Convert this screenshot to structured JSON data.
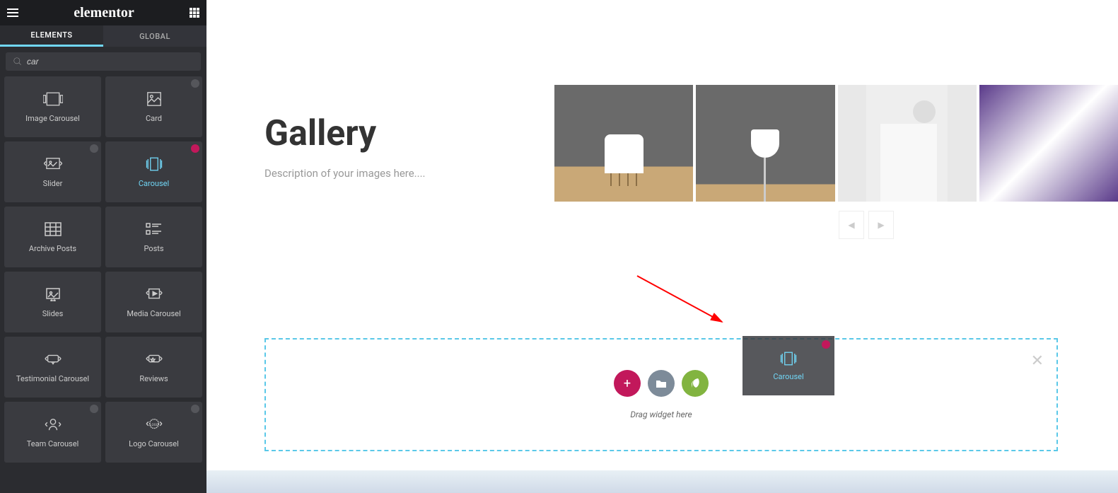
{
  "brand": "elementor",
  "tabs": {
    "elements": "ELEMENTS",
    "global": "GLOBAL"
  },
  "search": {
    "value": "car"
  },
  "widgets": [
    {
      "label": "Image Carousel",
      "badge": null
    },
    {
      "label": "Card",
      "badge": "gray"
    },
    {
      "label": "Slider",
      "badge": "gray"
    },
    {
      "label": "Carousel",
      "badge": "pink",
      "active": true
    },
    {
      "label": "Archive Posts",
      "badge": null
    },
    {
      "label": "Posts",
      "badge": null
    },
    {
      "label": "Slides",
      "badge": null
    },
    {
      "label": "Media Carousel",
      "badge": null
    },
    {
      "label": "Testimonial Carousel",
      "badge": null
    },
    {
      "label": "Reviews",
      "badge": null
    },
    {
      "label": "Team Carousel",
      "badge": "gray"
    },
    {
      "label": "Logo Carousel",
      "badge": "gray"
    }
  ],
  "gallery": {
    "title": "Gallery",
    "desc": "Description of your images here...."
  },
  "dropzone": {
    "hint": "Drag widget here"
  },
  "dragged": {
    "label": "Carousel"
  }
}
